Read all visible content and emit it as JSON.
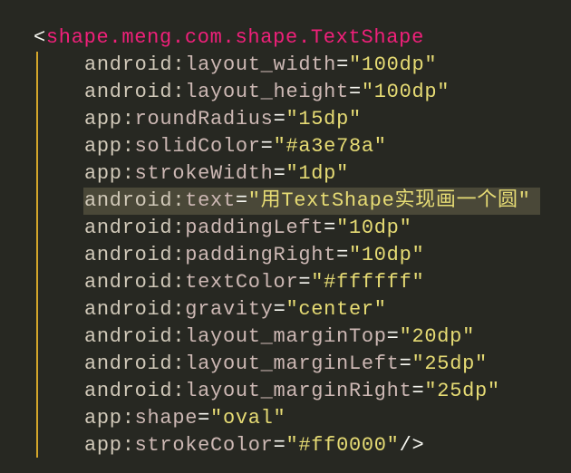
{
  "editor": {
    "open_bracket": "<",
    "tag": "shape.meng.com.shape.TextShape",
    "close": "/>",
    "attributes": [
      {
        "ns": "android",
        "name": "layout_width",
        "value": "\"100dp\""
      },
      {
        "ns": "android",
        "name": "layout_height",
        "value": "\"100dp\""
      },
      {
        "ns": "app",
        "name": "roundRadius",
        "value": "\"15dp\""
      },
      {
        "ns": "app",
        "name": "solidColor",
        "value": "\"#a3e78a\""
      },
      {
        "ns": "app",
        "name": "strokeWidth",
        "value": "\"1dp\""
      },
      {
        "ns": "android",
        "name": "text",
        "value": "\"用TextShape实现画一个圆\""
      },
      {
        "ns": "android",
        "name": "paddingLeft",
        "value": "\"10dp\""
      },
      {
        "ns": "android",
        "name": "paddingRight",
        "value": "\"10dp\""
      },
      {
        "ns": "android",
        "name": "textColor",
        "value": "\"#ffffff\""
      },
      {
        "ns": "android",
        "name": "gravity",
        "value": "\"center\""
      },
      {
        "ns": "android",
        "name": "layout_marginTop",
        "value": "\"20dp\""
      },
      {
        "ns": "android",
        "name": "layout_marginLeft",
        "value": "\"25dp\""
      },
      {
        "ns": "android",
        "name": "layout_marginRight",
        "value": "\"25dp\""
      },
      {
        "ns": "app",
        "name": "shape",
        "value": "\"oval\""
      },
      {
        "ns": "app",
        "name": "strokeColor",
        "value": "\"#ff0000\""
      }
    ],
    "highlighted_line": 6,
    "colors": {
      "background": "#272822",
      "tag": "#f0207a",
      "string": "#e6db74",
      "guide": "#d4a62a",
      "highlight": "#4a4838"
    }
  }
}
